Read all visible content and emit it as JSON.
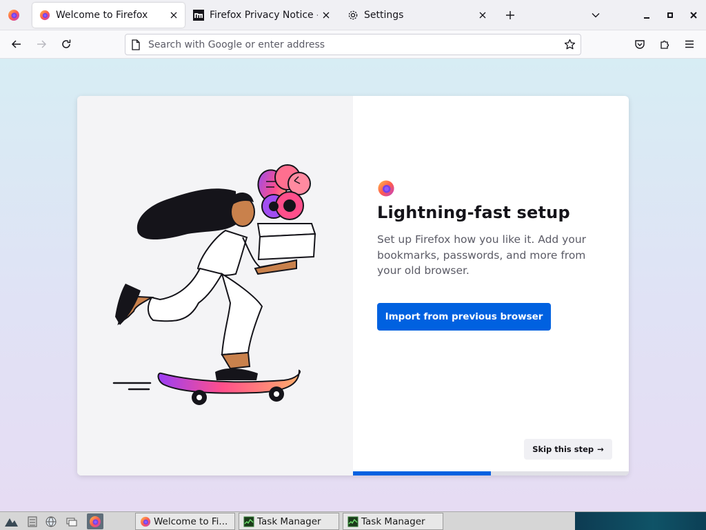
{
  "tabs": [
    {
      "title": "Welcome to Firefox",
      "icon": "firefox-icon",
      "active": true
    },
    {
      "title": "Firefox Privacy Notice —",
      "icon": "mozilla-icon",
      "active": false
    },
    {
      "title": "Settings",
      "icon": "gear-icon",
      "active": false
    }
  ],
  "urlbar": {
    "placeholder": "Search with Google or enter address"
  },
  "onboarding": {
    "title": "Lightning-fast setup",
    "description": "Set up Firefox how you like it. Add your bookmarks, passwords, and more from your old browser.",
    "import_label": "Import from previous browser",
    "skip_label": "Skip this step",
    "skip_arrow": "→",
    "progress": 0.5
  },
  "taskbar": {
    "tasks": [
      {
        "title": "Welcome to Fi...",
        "icon": "firefox-icon"
      },
      {
        "title": "Task Manager",
        "icon": "task-manager-icon"
      },
      {
        "title": "Task Manager",
        "icon": "task-manager-icon"
      }
    ]
  },
  "colors": {
    "accent": "#0061e0",
    "background_top": "#d7edf4",
    "background_bottom": "#e6dcf3"
  }
}
